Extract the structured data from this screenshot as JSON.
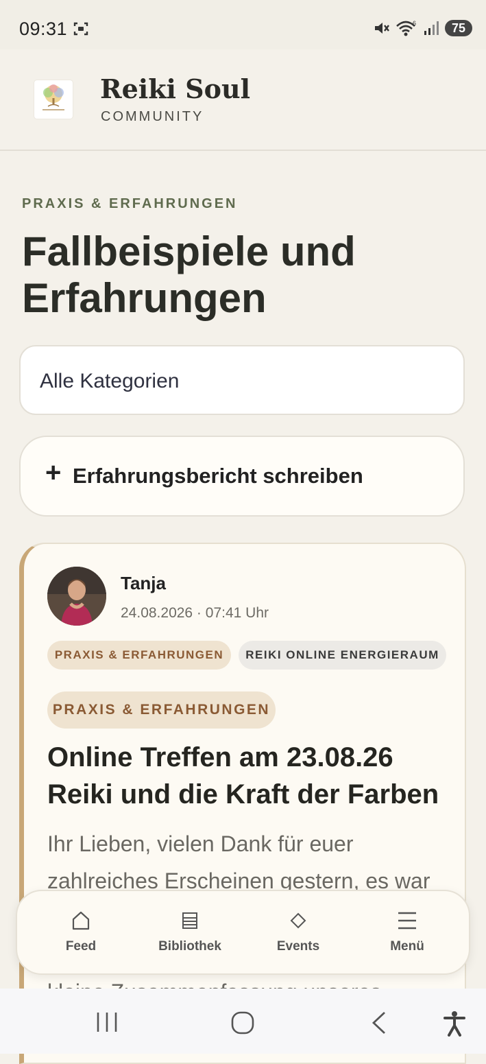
{
  "status_bar": {
    "time": "09:31",
    "battery": "75",
    "icons": [
      "screenshot-icon",
      "mute-icon",
      "wifi-icon",
      "signal-icon",
      "battery-icon"
    ]
  },
  "header": {
    "brand_name": "Reiki Soul",
    "brand_sub": "COMMUNITY"
  },
  "page": {
    "eyebrow": "PRAXIS & ERFAHRUNGEN",
    "title": "Fallbeispiele und Erfahrungen",
    "category_select": "Alle Kategorien",
    "write_button": "Erfahrungsbericht schreiben"
  },
  "post": {
    "author": "Tanja",
    "date": "24.08.2026 · 07:41 Uhr",
    "tags": [
      "PRAXIS & ERFAHRUNGEN",
      "REIKI ONLINE ENERGIERAUM"
    ],
    "category": "PRAXIS & ERFAHRUNGEN",
    "title": "Online Treffen am 23.08.26 Reiki und die Kraft der Farben",
    "body": "Ihr Lieben, vielen Dank für euer zahlreiches Erscheinen gestern, es war ... kleine Zusammenfassung unseres"
  },
  "bottom_nav": {
    "items": [
      {
        "label": "Feed",
        "icon": "home-icon"
      },
      {
        "label": "Bibliothek",
        "icon": "library-icon"
      },
      {
        "label": "Events",
        "icon": "diamond-icon"
      },
      {
        "label": "Menü",
        "icon": "menu-icon"
      }
    ]
  },
  "colors": {
    "background": "#f4f1ea",
    "accent_green": "#5f6b4e",
    "tag_brown": "#8a5a34",
    "card_border_accent": "#c8a777"
  }
}
